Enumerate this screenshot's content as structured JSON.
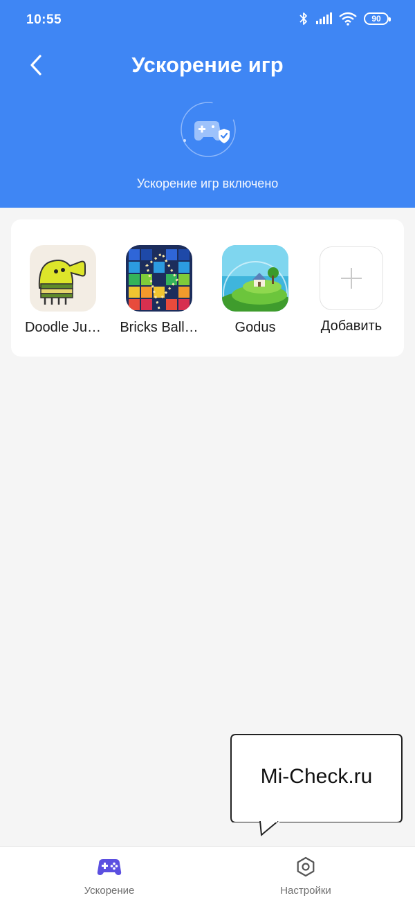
{
  "status_bar": {
    "time": "10:55",
    "battery": "90",
    "icons": [
      "bluetooth-icon",
      "signal-icon",
      "wifi-icon",
      "battery-icon"
    ]
  },
  "header": {
    "title": "Ускорение игр",
    "subtitle": "Ускорение игр включено",
    "back_icon": "chevron-left-icon",
    "badge_icon": "gamepad-shield-icon",
    "background_color": "#3f86f4"
  },
  "games": [
    {
      "label": "Doodle Ju…",
      "icon": "doodle-jump-app-icon"
    },
    {
      "label": "Bricks Ball…",
      "icon": "bricks-ball-app-icon"
    },
    {
      "label": "Godus",
      "icon": "godus-app-icon"
    }
  ],
  "add_game": {
    "label": "Добавить",
    "icon": "plus-icon"
  },
  "watermark": {
    "text": "Mi-Check.ru"
  },
  "tabs": [
    {
      "label": "Ускорение",
      "icon": "gamepad-icon",
      "color": "#5b4fe0"
    },
    {
      "label": "Настройки",
      "icon": "gear-icon",
      "color": "#555555"
    }
  ]
}
